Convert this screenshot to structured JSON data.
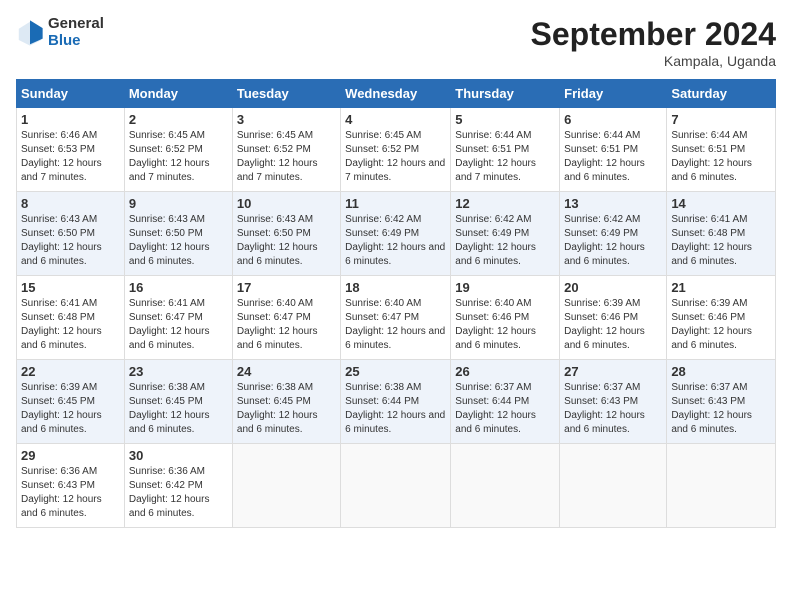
{
  "logo": {
    "general": "General",
    "blue": "Blue"
  },
  "title": "September 2024",
  "subtitle": "Kampala, Uganda",
  "days_of_week": [
    "Sunday",
    "Monday",
    "Tuesday",
    "Wednesday",
    "Thursday",
    "Friday",
    "Saturday"
  ],
  "weeks": [
    [
      {
        "num": "1",
        "sunrise": "6:46 AM",
        "sunset": "6:53 PM",
        "daylight": "12 hours and 7 minutes."
      },
      {
        "num": "2",
        "sunrise": "6:45 AM",
        "sunset": "6:52 PM",
        "daylight": "12 hours and 7 minutes."
      },
      {
        "num": "3",
        "sunrise": "6:45 AM",
        "sunset": "6:52 PM",
        "daylight": "12 hours and 7 minutes."
      },
      {
        "num": "4",
        "sunrise": "6:45 AM",
        "sunset": "6:52 PM",
        "daylight": "12 hours and 7 minutes."
      },
      {
        "num": "5",
        "sunrise": "6:44 AM",
        "sunset": "6:51 PM",
        "daylight": "12 hours and 7 minutes."
      },
      {
        "num": "6",
        "sunrise": "6:44 AM",
        "sunset": "6:51 PM",
        "daylight": "12 hours and 6 minutes."
      },
      {
        "num": "7",
        "sunrise": "6:44 AM",
        "sunset": "6:51 PM",
        "daylight": "12 hours and 6 minutes."
      }
    ],
    [
      {
        "num": "8",
        "sunrise": "6:43 AM",
        "sunset": "6:50 PM",
        "daylight": "12 hours and 6 minutes."
      },
      {
        "num": "9",
        "sunrise": "6:43 AM",
        "sunset": "6:50 PM",
        "daylight": "12 hours and 6 minutes."
      },
      {
        "num": "10",
        "sunrise": "6:43 AM",
        "sunset": "6:50 PM",
        "daylight": "12 hours and 6 minutes."
      },
      {
        "num": "11",
        "sunrise": "6:42 AM",
        "sunset": "6:49 PM",
        "daylight": "12 hours and 6 minutes."
      },
      {
        "num": "12",
        "sunrise": "6:42 AM",
        "sunset": "6:49 PM",
        "daylight": "12 hours and 6 minutes."
      },
      {
        "num": "13",
        "sunrise": "6:42 AM",
        "sunset": "6:49 PM",
        "daylight": "12 hours and 6 minutes."
      },
      {
        "num": "14",
        "sunrise": "6:41 AM",
        "sunset": "6:48 PM",
        "daylight": "12 hours and 6 minutes."
      }
    ],
    [
      {
        "num": "15",
        "sunrise": "6:41 AM",
        "sunset": "6:48 PM",
        "daylight": "12 hours and 6 minutes."
      },
      {
        "num": "16",
        "sunrise": "6:41 AM",
        "sunset": "6:47 PM",
        "daylight": "12 hours and 6 minutes."
      },
      {
        "num": "17",
        "sunrise": "6:40 AM",
        "sunset": "6:47 PM",
        "daylight": "12 hours and 6 minutes."
      },
      {
        "num": "18",
        "sunrise": "6:40 AM",
        "sunset": "6:47 PM",
        "daylight": "12 hours and 6 minutes."
      },
      {
        "num": "19",
        "sunrise": "6:40 AM",
        "sunset": "6:46 PM",
        "daylight": "12 hours and 6 minutes."
      },
      {
        "num": "20",
        "sunrise": "6:39 AM",
        "sunset": "6:46 PM",
        "daylight": "12 hours and 6 minutes."
      },
      {
        "num": "21",
        "sunrise": "6:39 AM",
        "sunset": "6:46 PM",
        "daylight": "12 hours and 6 minutes."
      }
    ],
    [
      {
        "num": "22",
        "sunrise": "6:39 AM",
        "sunset": "6:45 PM",
        "daylight": "12 hours and 6 minutes."
      },
      {
        "num": "23",
        "sunrise": "6:38 AM",
        "sunset": "6:45 PM",
        "daylight": "12 hours and 6 minutes."
      },
      {
        "num": "24",
        "sunrise": "6:38 AM",
        "sunset": "6:45 PM",
        "daylight": "12 hours and 6 minutes."
      },
      {
        "num": "25",
        "sunrise": "6:38 AM",
        "sunset": "6:44 PM",
        "daylight": "12 hours and 6 minutes."
      },
      {
        "num": "26",
        "sunrise": "6:37 AM",
        "sunset": "6:44 PM",
        "daylight": "12 hours and 6 minutes."
      },
      {
        "num": "27",
        "sunrise": "6:37 AM",
        "sunset": "6:43 PM",
        "daylight": "12 hours and 6 minutes."
      },
      {
        "num": "28",
        "sunrise": "6:37 AM",
        "sunset": "6:43 PM",
        "daylight": "12 hours and 6 minutes."
      }
    ],
    [
      {
        "num": "29",
        "sunrise": "6:36 AM",
        "sunset": "6:43 PM",
        "daylight": "12 hours and 6 minutes."
      },
      {
        "num": "30",
        "sunrise": "6:36 AM",
        "sunset": "6:42 PM",
        "daylight": "12 hours and 6 minutes."
      },
      null,
      null,
      null,
      null,
      null
    ]
  ]
}
